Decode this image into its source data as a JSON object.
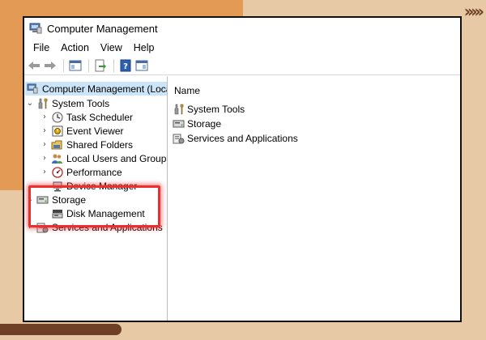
{
  "window": {
    "title": "Computer Management"
  },
  "menu": {
    "file": "File",
    "action": "Action",
    "view": "View",
    "help": "Help"
  },
  "tree": {
    "root": "Computer Management (Local)",
    "system_tools": "System Tools",
    "task_scheduler": "Task Scheduler",
    "event_viewer": "Event Viewer",
    "shared_folders": "Shared Folders",
    "local_users": "Local Users and Groups",
    "performance": "Performance",
    "device_manager": "Device Manager",
    "storage": "Storage",
    "disk_management": "Disk Management",
    "services": "Services and Applications"
  },
  "main": {
    "header": "Name",
    "items": [
      "System Tools",
      "Storage",
      "Services and Applications"
    ]
  },
  "colors": {
    "highlight": "#ef2d2d",
    "selection": "#cce4f7",
    "background": "#e8c9a6",
    "accent_orange": "#e39a55",
    "accent_brown": "#6e4126"
  },
  "decoration": {
    "arrows": "›››››"
  }
}
